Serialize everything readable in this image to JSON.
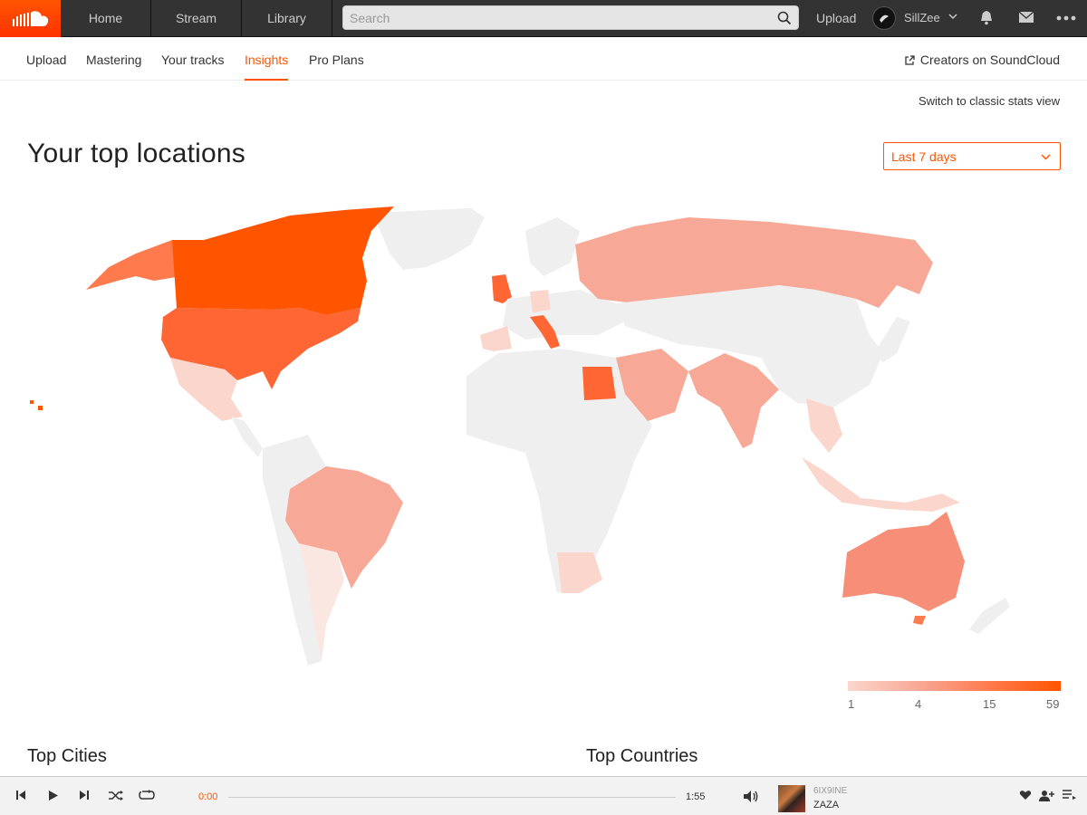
{
  "topnav": {
    "items": [
      "Home",
      "Stream",
      "Library"
    ],
    "search_placeholder": "Search",
    "upload": "Upload",
    "username": "SillZee"
  },
  "subnav": {
    "tabs": [
      "Upload",
      "Mastering",
      "Your tracks",
      "Insights",
      "Pro Plans"
    ],
    "active": "Insights",
    "creators_link": "Creators on SoundCloud"
  },
  "insights": {
    "classic_link": "Switch to classic stats view",
    "title": "Your top locations",
    "range_value": "Last 7 days",
    "legend_labels": [
      "1",
      "4",
      "15",
      "59"
    ],
    "top_cities_title": "Top Cities",
    "top_countries_title": "Top Countries"
  },
  "colors": {
    "accent": "#ff5500",
    "map_none": "#efefef",
    "map_low": "#fbd6cc",
    "map_mid": "#f7a896",
    "map_high": "#ff7a4d",
    "map_top": "#ff5500"
  },
  "player": {
    "current_time": "0:00",
    "total_time": "1:55",
    "artist": "6IX9INE",
    "track": "ZAZA"
  }
}
